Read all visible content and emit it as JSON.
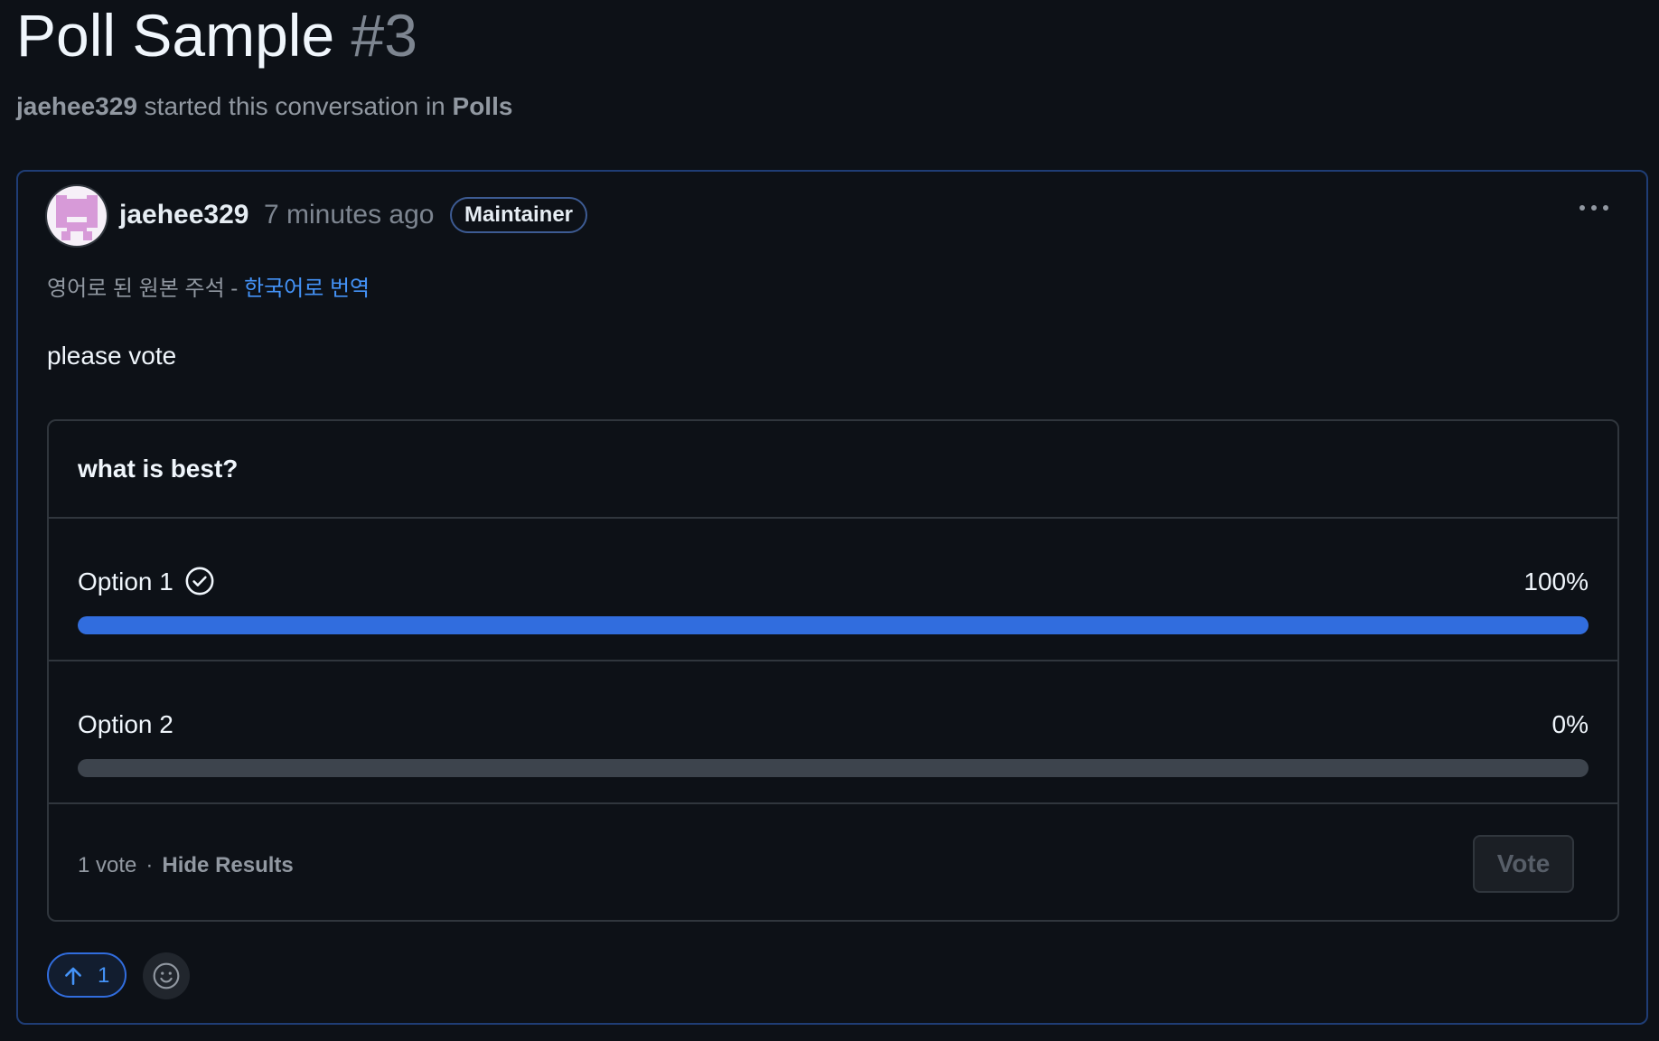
{
  "discussion": {
    "title": "Poll Sample",
    "number": "#3",
    "starter": "jaehee329",
    "started_text": "started this conversation in",
    "category": "Polls"
  },
  "comment": {
    "author": "jaehee329",
    "time": "7 minutes ago",
    "role_badge": "Maintainer",
    "more_icon": "kebab-horizontal-icon",
    "translation_note": "영어로 된 원본 주석 -",
    "translation_link": "한국어로 번역",
    "body": "please vote",
    "upvote_count": "1",
    "upvote_icon": "arrow-up-icon",
    "reaction_icon": "smiley-icon"
  },
  "poll": {
    "question": "what is best?",
    "options": [
      {
        "label": "Option 1",
        "percent_text": "100%",
        "fraction": 1.0,
        "voted": true,
        "voted_icon": "check-circle-icon"
      },
      {
        "label": "Option 2",
        "percent_text": "0%",
        "fraction": 0.0,
        "voted": false
      }
    ],
    "vote_count": "1 vote",
    "separator": "·",
    "hide_results": "Hide Results",
    "vote_button": "Vote"
  },
  "colors": {
    "background": "#0d1117",
    "accent_blue": "#316dde",
    "link_blue": "#4493f8",
    "border": "#30363d",
    "muted_text": "#9198a1"
  }
}
